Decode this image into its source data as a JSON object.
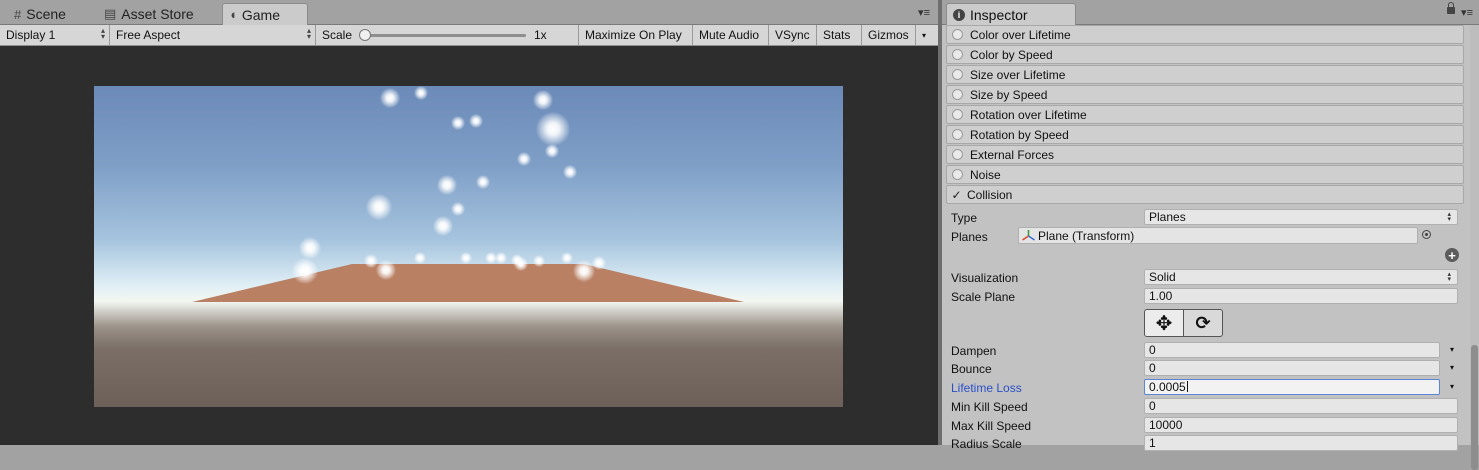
{
  "tabs": {
    "scene": {
      "label": "Scene",
      "icon": "hash-icon"
    },
    "asset_store": {
      "label": "Asset Store",
      "icon": "store-icon"
    },
    "game": {
      "label": "Game",
      "icon": "pacman-icon"
    }
  },
  "game_toolbar": {
    "display": "Display 1",
    "aspect": "Free Aspect",
    "scale_label": "Scale",
    "scale_value": "1x",
    "scale_slider_fraction": 0,
    "maximize": "Maximize On Play",
    "mute": "Mute Audio",
    "vsync": "VSync",
    "stats": "Stats",
    "gizmos": "Gizmos"
  },
  "inspector": {
    "title": "Inspector",
    "modules": [
      {
        "label": "Color over Lifetime",
        "enabled": false
      },
      {
        "label": "Color by Speed",
        "enabled": false
      },
      {
        "label": "Size over Lifetime",
        "enabled": false
      },
      {
        "label": "Size by Speed",
        "enabled": false
      },
      {
        "label": "Rotation over Lifetime",
        "enabled": false
      },
      {
        "label": "Rotation by Speed",
        "enabled": false
      },
      {
        "label": "External Forces",
        "enabled": false
      },
      {
        "label": "Noise",
        "enabled": false
      },
      {
        "label": "Collision",
        "enabled": true
      }
    ],
    "collision": {
      "type_label": "Type",
      "type_value": "Planes",
      "planes_label": "Planes",
      "planes_value": "Plane (Transform)",
      "visualization_label": "Visualization",
      "visualization_value": "Solid",
      "scale_plane_label": "Scale Plane",
      "scale_plane_value": "1.00",
      "dampen_label": "Dampen",
      "dampen_value": "0",
      "bounce_label": "Bounce",
      "bounce_value": "0",
      "lifetime_loss_label": "Lifetime Loss",
      "lifetime_loss_value": "0.0005",
      "min_kill_label": "Min Kill Speed",
      "min_kill_value": "0",
      "max_kill_label": "Max Kill Speed",
      "max_kill_value": "10000",
      "radius_scale_label": "Radius Scale",
      "radius_scale_value": "1"
    }
  },
  "colors": {
    "highlight_label": "#2a50c8",
    "plane": "#b98064"
  }
}
